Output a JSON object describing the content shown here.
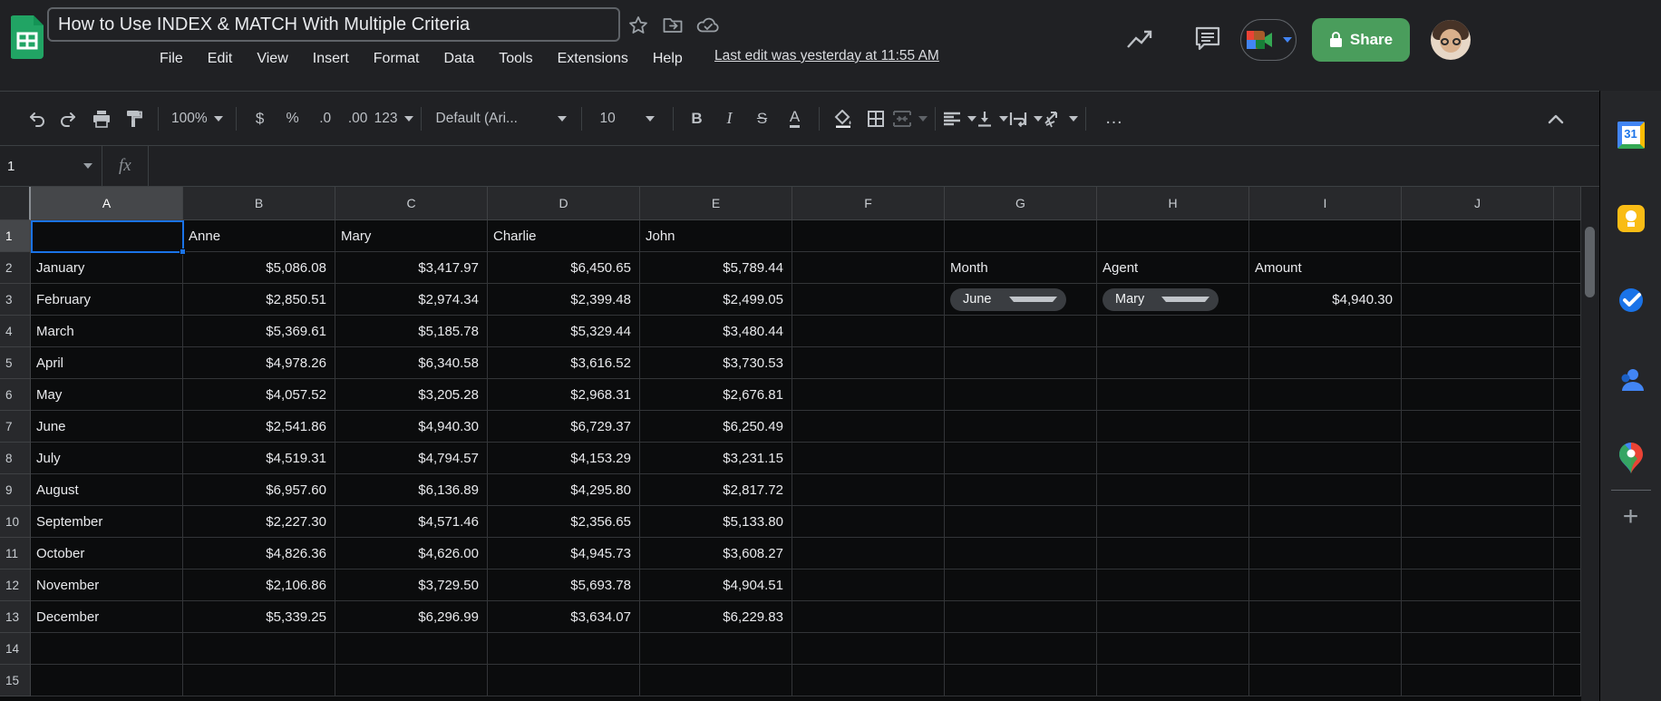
{
  "header": {
    "title": "How to Use INDEX & MATCH With Multiple Criteria",
    "menu": [
      "File",
      "Edit",
      "View",
      "Insert",
      "Format",
      "Data",
      "Tools",
      "Extensions",
      "Help"
    ],
    "last_edit": "Last edit was yesterday at 11:55 AM",
    "share_label": "Share",
    "icons": [
      "star-icon",
      "move-folder-icon",
      "cloud-saved-icon",
      "trending-icon",
      "comment-icon",
      "meet-camera-icon",
      "lock-icon",
      "avatar"
    ]
  },
  "toolbar": {
    "zoom": "100%",
    "currency": "$",
    "percent": "%",
    "dec_less": ".0",
    "dec_more": ".00",
    "num_format": "123",
    "font_name": "Default (Ari...",
    "font_size": "10",
    "bold": "B",
    "italic": "I",
    "strikethrough": "S",
    "text_color": "A",
    "more": "…",
    "icons": [
      "undo-icon",
      "redo-icon",
      "print-icon",
      "paint-format-icon",
      "fill-color-icon",
      "borders-icon",
      "merge-cells-icon",
      "horizontal-align-icon",
      "vertical-align-icon",
      "text-wrap-icon",
      "text-rotation-icon",
      "collapse-toolbar-icon"
    ]
  },
  "formula_bar": {
    "name_box": "1",
    "fx": "fx"
  },
  "sheet": {
    "columns": [
      "A",
      "B",
      "C",
      "D",
      "E",
      "F",
      "G",
      "H",
      "I",
      "J"
    ],
    "row_count": 15,
    "header_row": {
      "B": "Anne",
      "C": "Mary",
      "D": "Charlie",
      "E": "John"
    },
    "months": [
      "January",
      "February",
      "March",
      "April",
      "May",
      "June",
      "July",
      "August",
      "September",
      "October",
      "November",
      "December"
    ],
    "amount_rows": [
      [
        "$5,086.08",
        "$3,417.97",
        "$6,450.65",
        "$5,789.44"
      ],
      [
        "$2,850.51",
        "$2,974.34",
        "$2,399.48",
        "$2,499.05"
      ],
      [
        "$5,369.61",
        "$5,185.78",
        "$5,329.44",
        "$3,480.44"
      ],
      [
        "$4,978.26",
        "$6,340.58",
        "$3,616.52",
        "$3,730.53"
      ],
      [
        "$4,057.52",
        "$3,205.28",
        "$2,968.31",
        "$2,676.81"
      ],
      [
        "$2,541.86",
        "$4,940.30",
        "$6,729.37",
        "$6,250.49"
      ],
      [
        "$4,519.31",
        "$4,794.57",
        "$4,153.29",
        "$3,231.15"
      ],
      [
        "$6,957.60",
        "$6,136.89",
        "$4,295.80",
        "$2,817.72"
      ],
      [
        "$2,227.30",
        "$4,571.46",
        "$2,356.65",
        "$5,133.80"
      ],
      [
        "$4,826.36",
        "$4,626.00",
        "$4,945.73",
        "$3,608.27"
      ],
      [
        "$2,106.86",
        "$3,729.50",
        "$5,693.78",
        "$4,904.51"
      ],
      [
        "$5,339.25",
        "$6,296.99",
        "$3,634.07",
        "$6,229.83"
      ]
    ],
    "lookup": {
      "month_label": "Month",
      "agent_label": "Agent",
      "amount_label": "Amount",
      "month_value": "June",
      "agent_value": "Mary",
      "amount_value": "$4,940.30"
    }
  },
  "side_panel": {
    "icons": [
      "calendar-icon",
      "keep-icon",
      "tasks-icon",
      "contacts-icon",
      "maps-icon"
    ],
    "plus": "+"
  },
  "colors": {
    "accent_blue": "#1a73e8",
    "share_green": "#4a9d5c",
    "chrome_bg": "#202124",
    "grid_bg": "#0b0c0d",
    "header_cell_bg": "#28292c",
    "chip_bg": "#3a3d41"
  }
}
